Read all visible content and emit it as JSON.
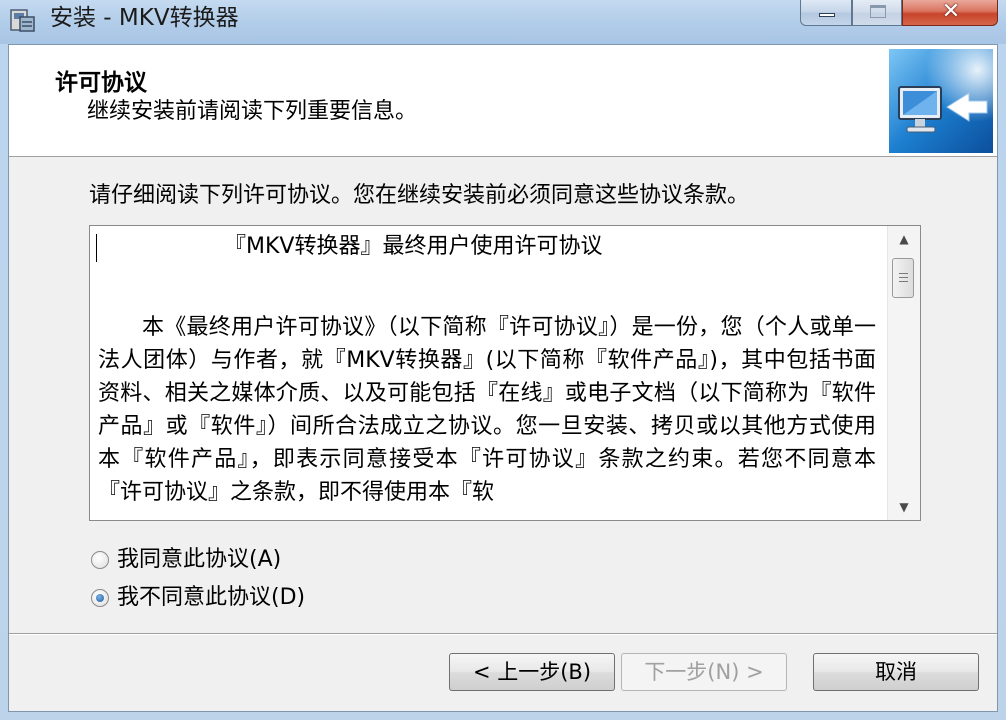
{
  "window": {
    "title": "安装 - MKV转换器",
    "controls": [
      "minimize",
      "maximize",
      "close"
    ]
  },
  "header": {
    "title": "许可协议",
    "subtitle": "继续安装前请阅读下列重要信息。"
  },
  "intro": "请仔细阅读下列许可协议。您在继续安装前必须同意这些协议条款。",
  "license": {
    "title": "『MKV转换器』最终用户使用许可协议",
    "body": "本《最终用户许可协议》（以下简称『许可协议』）是一份，您（个人或单一法人团体）与作者，就『MKV转换器』(以下简称『软件产品』)，其中包括书面资料、相关之媒体介质、以及可能包括『在线』或电子文档（以下简称为『软件产品』或『软件』）间所合法成立之协议。您一旦安装、拷贝或以其他方式使用本『软件产品』，即表示同意接受本『许可协议』条款之约束。若您不同意本『许可协议』之条款，即不得使用本『软"
  },
  "options": {
    "accept": {
      "label": "我同意此协议(A)",
      "checked": false
    },
    "decline": {
      "label": "我不同意此协议(D)",
      "checked": true
    }
  },
  "buttons": {
    "back": "< 上一步(B)",
    "next": "下一步(N) >",
    "next_enabled": false,
    "cancel": "取消"
  },
  "colors": {
    "title_bar": "#b2cde9",
    "dialog_bg": "#f0f0f0",
    "close_button": "#c7452b"
  }
}
